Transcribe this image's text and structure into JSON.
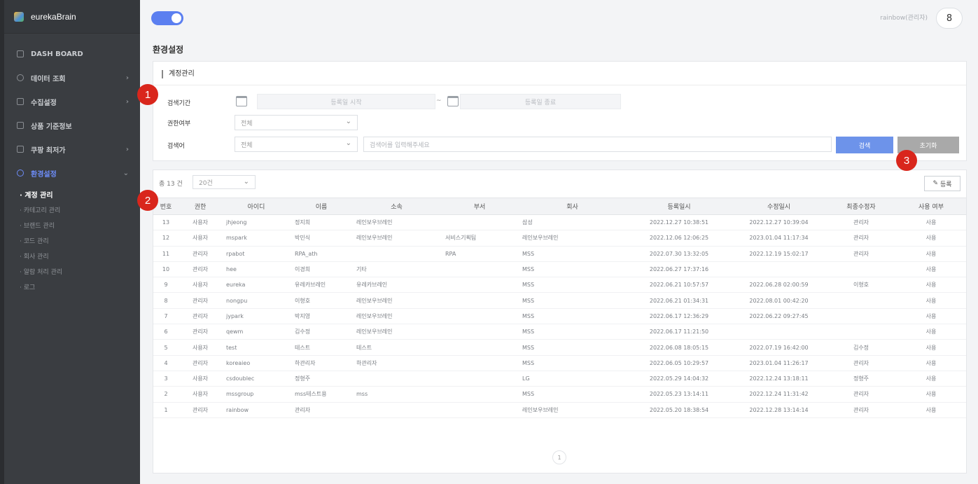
{
  "app": {
    "name": "eurekaBrain"
  },
  "sidebar": {
    "items": [
      {
        "label": "DASH BOARD",
        "icon": "home-icon",
        "has_children": false
      },
      {
        "label": "데이터 조회",
        "icon": "search-icon",
        "has_children": true
      },
      {
        "label": "수집설정",
        "icon": "settings-icon",
        "has_children": true
      },
      {
        "label": "상품 기준정보",
        "icon": "box-icon",
        "has_children": false
      },
      {
        "label": "쿠팡 최저가",
        "icon": "list-icon",
        "has_children": true
      },
      {
        "label": "환경설정",
        "icon": "gear-icon",
        "has_children": true,
        "active": true
      }
    ],
    "sub_items": [
      {
        "label": "· 계정 관리",
        "current": true
      },
      {
        "label": "· 카테고리 관리"
      },
      {
        "label": "· 브랜드 관리"
      },
      {
        "label": "· 코드 관리"
      },
      {
        "label": "· 회사 관리"
      },
      {
        "label": "· 알람 처리 관리"
      },
      {
        "label": "· 로그"
      }
    ]
  },
  "header": {
    "user_label": "rainbow(관리자)",
    "badge": "8"
  },
  "page": {
    "title": "환경설정"
  },
  "search_card": {
    "title": "계정관리",
    "period_label": "검색기간",
    "start_placeholder": "등록일 시작",
    "separator": "~",
    "end_placeholder": "등록일 종료",
    "auth_label": "권한여부",
    "auth_value": "전체",
    "keyword_label": "검색어",
    "keyword_type": "전체",
    "keyword_placeholder": "검색어를 입력해주세요",
    "search_button": "검색",
    "reset_button": "초기화"
  },
  "list_card": {
    "total": "총 13 건",
    "page_size": "20건",
    "register_button": "등록",
    "pager": "1"
  },
  "table": {
    "headers": [
      "번호",
      "권한",
      "아이디",
      "이름",
      "소속",
      "부서",
      "회사",
      "등록일시",
      "수정일시",
      "최종수정자",
      "사용 여부"
    ],
    "rows": [
      [
        "13",
        "사용자",
        "jhjeong",
        "정지희",
        "레인보우브레인",
        "",
        "삼성",
        "2022.12.27 10:38:51",
        "2022.12.27 10:39:04",
        "관리자",
        "사용"
      ],
      [
        "12",
        "사용자",
        "mspark",
        "박민식",
        "레인보우브레인",
        "서비스기획팀",
        "레인보우브레인",
        "2022.12.06 12:06:25",
        "2023.01.04 11:17:34",
        "관리자",
        "사용"
      ],
      [
        "11",
        "관리자",
        "rpabot",
        "RPA_ath",
        "",
        "RPA",
        "MSS",
        "2022.07.30 13:32:05",
        "2022.12.19 15:02:17",
        "관리자",
        "사용"
      ],
      [
        "10",
        "관리자",
        "hee",
        "이경희",
        "기타",
        "",
        "MSS",
        "2022.06.27 17:37:16",
        "",
        "",
        "사용"
      ],
      [
        "9",
        "사용자",
        "eureka",
        "유레카브레인",
        "유레카브레인",
        "",
        "MSS",
        "2022.06.21 10:57:57",
        "2022.06.28 02:00:59",
        "이형호",
        "사용"
      ],
      [
        "8",
        "관리자",
        "nongpu",
        "이형호",
        "레인보우브레인",
        "",
        "MSS",
        "2022.06.21 01:34:31",
        "2022.08.01 00:42:20",
        "",
        "사용"
      ],
      [
        "7",
        "관리자",
        "jypark",
        "박지영",
        "레인보우브레인",
        "",
        "MSS",
        "2022.06.17 12:36:29",
        "2022.06.22 09:27:45",
        "",
        "사용"
      ],
      [
        "6",
        "관리자",
        "qewm",
        "김수정",
        "레인보우브레인",
        "",
        "MSS",
        "2022.06.17 11:21:50",
        "",
        "",
        "사용"
      ],
      [
        "5",
        "사용자",
        "test",
        "테스트",
        "테스트",
        "",
        "MSS",
        "2022.06.08 18:05:15",
        "2022.07.19 16:42:00",
        "김수정",
        "사용"
      ],
      [
        "4",
        "관리자",
        "koreaieo",
        "하관리자",
        "하관리자",
        "",
        "MSS",
        "2022.06.05 10:29:57",
        "2023.01.04 11:26:17",
        "관리자",
        "사용"
      ],
      [
        "3",
        "사용자",
        "csdoublec",
        "정형주",
        "",
        "",
        "LG",
        "2022.05.29 14:04:32",
        "2022.12.24 13:18:11",
        "정형주",
        "사용"
      ],
      [
        "2",
        "사용자",
        "mssgroup",
        "mss테스트용",
        "mss",
        "",
        "MSS",
        "2022.05.23 13:14:11",
        "2022.12.24 11:31:42",
        "관리자",
        "사용"
      ],
      [
        "1",
        "관리자",
        "rainbow",
        "관리자",
        "",
        "",
        "레인보우브레인",
        "2022.05.20 18:38:54",
        "2022.12.28 13:14:14",
        "관리자",
        "사용"
      ]
    ]
  },
  "markers": [
    "1",
    "2",
    "3"
  ]
}
